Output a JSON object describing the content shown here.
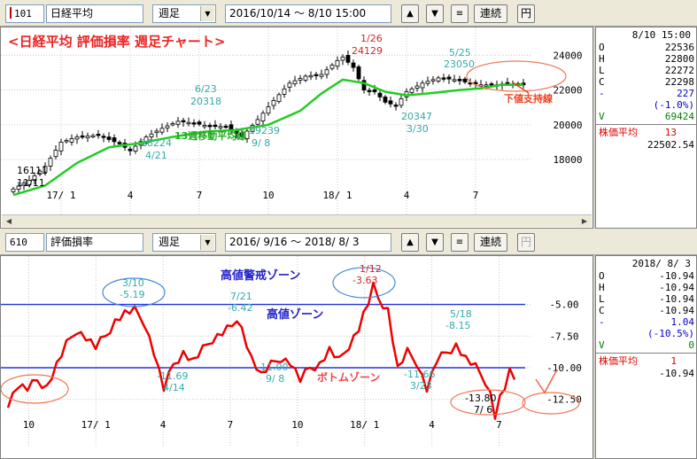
{
  "top": {
    "toolbar": {
      "code": "101",
      "name": "日経平均",
      "period": "週足",
      "date_range": "2016/10/14 ～  8/10 15:00",
      "list_button": "≡",
      "renzoku_button": "連続",
      "yen_button": "円"
    },
    "chart_title": "<日経平均  評価損率  週足チャート>",
    "annotations": {
      "ma_label": "13週移動平均線",
      "support_label": "下値支持線",
      "pk_1126": "1/26",
      "pk_1126_v": "24129",
      "pk_525": "5/25",
      "pk_525_v": "23050",
      "pk_623": "6/23",
      "pk_623_v": "20318",
      "lo_1111_v": "16111",
      "lo_1111": "11/11",
      "lo_421_v": "18224",
      "lo_421": "4/21",
      "lo_98_v": "19239",
      "lo_98": "9/ 8",
      "lo_330_v": "20347",
      "lo_330": "3/30"
    },
    "info": {
      "date": "8/10 15:00",
      "rows": [
        {
          "k": "O",
          "v": "22536"
        },
        {
          "k": "H",
          "v": "22800"
        },
        {
          "k": "L",
          "v": "22272"
        },
        {
          "k": "C",
          "v": "22298"
        },
        {
          "k": "-",
          "v": "227"
        },
        {
          "k": "",
          "v": "(-1.0%)"
        },
        {
          "k": "V",
          "v": "69424"
        }
      ],
      "sub_label": "株価平均",
      "sub_period": "13",
      "sub_value": "22502.54"
    }
  },
  "bottom": {
    "toolbar": {
      "code": "610",
      "name": "評価損率",
      "period": "週足",
      "date_range": "2016/ 9/16 ～  2018/ 8/ 3",
      "list_button": "≡",
      "renzoku_button": "連続",
      "yen_button": "円"
    },
    "annotations": {
      "zone_warn": "高値警戒ゾーン",
      "zone_high": "高値ゾーン",
      "zone_bottom": "ボトムゾーン",
      "pk_310": "3/10",
      "pk_310_v": "-5.19",
      "pk_721": "7/21",
      "pk_721_v": "-6.42",
      "pk_112": "1/12",
      "pk_112_v": "-3.63",
      "pk_518": "5/18",
      "pk_518_v": "-8.15",
      "lo_414_v": "-11.69",
      "lo_414": "4/14",
      "lo_98_v": "-11.00",
      "lo_98": "9/ 8",
      "lo_323_v": "-11.66",
      "lo_323": "3/23",
      "lo_76_v": "-13.80",
      "lo_76": "7/ 6"
    },
    "info": {
      "date": "2018/ 8/ 3",
      "rows": [
        {
          "k": "O",
          "v": "-10.94"
        },
        {
          "k": "H",
          "v": "-10.94"
        },
        {
          "k": "L",
          "v": "-10.94"
        },
        {
          "k": "C",
          "v": "-10.94"
        },
        {
          "k": "-",
          "v": "1.04"
        },
        {
          "k": "",
          "v": "(-10.5%)"
        },
        {
          "k": "V",
          "v": "0"
        }
      ],
      "sub_label": "株価平均",
      "sub_period": "1",
      "sub_value": "-10.94"
    }
  },
  "chart_data": [
    {
      "type": "candlestick",
      "title": "<日経平均  評価損率  週足チャート>",
      "ylim": [
        15600,
        25400
      ],
      "y_ticks": [
        "18000",
        "20000",
        "22000",
        "24000"
      ],
      "x_ticks": [
        "17/ 1",
        "4",
        "7",
        "10",
        "18/ 1",
        "4",
        "7"
      ],
      "x_tick_index": [
        9,
        22,
        35,
        48,
        61,
        74,
        87
      ],
      "n_weeks": 97,
      "series_name": "13週移動平均線",
      "close_anchors": [
        [
          0,
          16300
        ],
        [
          3,
          16800
        ],
        [
          6,
          17600
        ],
        [
          9,
          19000
        ],
        [
          12,
          19300
        ],
        [
          16,
          19400
        ],
        [
          20,
          18900
        ],
        [
          22,
          18500
        ],
        [
          25,
          19300
        ],
        [
          28,
          19800
        ],
        [
          31,
          20200
        ],
        [
          34,
          20100
        ],
        [
          37,
          19900
        ],
        [
          40,
          19900
        ],
        [
          43,
          19300
        ],
        [
          46,
          20300
        ],
        [
          49,
          21400
        ],
        [
          52,
          22400
        ],
        [
          55,
          22800
        ],
        [
          58,
          22900
        ],
        [
          61,
          23700
        ],
        [
          62,
          23900
        ],
        [
          64,
          23300
        ],
        [
          66,
          22000
        ],
        [
          68,
          21900
        ],
        [
          70,
          21300
        ],
        [
          72,
          21100
        ],
        [
          74,
          21900
        ],
        [
          77,
          22400
        ],
        [
          80,
          22700
        ],
        [
          83,
          22600
        ],
        [
          86,
          22400
        ],
        [
          88,
          22300
        ],
        [
          91,
          22300
        ],
        [
          93,
          22400
        ],
        [
          95,
          22300
        ]
      ],
      "ma_anchors": [
        [
          0,
          15950
        ],
        [
          6,
          16500
        ],
        [
          12,
          17800
        ],
        [
          18,
          18700
        ],
        [
          24,
          18950
        ],
        [
          30,
          19300
        ],
        [
          36,
          19600
        ],
        [
          42,
          19700
        ],
        [
          48,
          20000
        ],
        [
          54,
          20800
        ],
        [
          58,
          21800
        ],
        [
          62,
          22600
        ],
        [
          66,
          22400
        ],
        [
          70,
          21900
        ],
        [
          74,
          21700
        ],
        [
          78,
          21800
        ],
        [
          84,
          22000
        ],
        [
          88,
          22100
        ],
        [
          92,
          22300
        ],
        [
          95,
          22300
        ]
      ]
    },
    {
      "type": "line",
      "series_name": "評価損率",
      "ylim": [
        -15.6,
        -1.6
      ],
      "y_ticks": [
        "-5.00",
        "-7.50",
        "-10.00",
        "-12.50"
      ],
      "x_ticks": [
        "10",
        "17/ 1",
        "4",
        "7",
        "10",
        "18/ 1",
        "4",
        "7"
      ],
      "x_tick_index": [
        4,
        17,
        30,
        43,
        56,
        69,
        82,
        95
      ],
      "n_weeks": 99,
      "hlines": [
        -5.0,
        -10.0
      ],
      "anchors": [
        [
          0,
          -12.8
        ],
        [
          2,
          -11.4
        ],
        [
          4,
          -11.7
        ],
        [
          6,
          -11.0
        ],
        [
          8,
          -11.5
        ],
        [
          10,
          -9.8
        ],
        [
          12,
          -8.2
        ],
        [
          14,
          -7.0
        ],
        [
          16,
          -7.6
        ],
        [
          18,
          -8.4
        ],
        [
          20,
          -7.5
        ],
        [
          22,
          -6.3
        ],
        [
          24,
          -5.7
        ],
        [
          26,
          -5.5
        ],
        [
          28,
          -6.4
        ],
        [
          30,
          -8.8
        ],
        [
          32,
          -11.7
        ],
        [
          34,
          -9.7
        ],
        [
          36,
          -8.8
        ],
        [
          38,
          -9.5
        ],
        [
          40,
          -8.6
        ],
        [
          42,
          -7.7
        ],
        [
          44,
          -7.2
        ],
        [
          46,
          -6.6
        ],
        [
          48,
          -6.8
        ],
        [
          50,
          -9.2
        ],
        [
          52,
          -10.6
        ],
        [
          54,
          -9.8
        ],
        [
          56,
          -9.2
        ],
        [
          58,
          -9.6
        ],
        [
          60,
          -11.0
        ],
        [
          62,
          -10.0
        ],
        [
          64,
          -9.7
        ],
        [
          66,
          -8.6
        ],
        [
          68,
          -9.5
        ],
        [
          70,
          -8.2
        ],
        [
          72,
          -6.9
        ],
        [
          73,
          -5.8
        ],
        [
          74,
          -4.9
        ],
        [
          75,
          -3.63
        ],
        [
          76,
          -4.5
        ],
        [
          78,
          -5.4
        ],
        [
          80,
          -10.1
        ],
        [
          82,
          -8.8
        ],
        [
          84,
          -9.6
        ],
        [
          86,
          -11.66
        ],
        [
          88,
          -9.5
        ],
        [
          90,
          -8.8
        ],
        [
          92,
          -8.2
        ],
        [
          94,
          -9.3
        ],
        [
          96,
          -10.0
        ],
        [
          98,
          -11.0
        ],
        [
          99,
          -12.0
        ],
        [
          100,
          -13.8
        ],
        [
          101,
          -12.4
        ],
        [
          102,
          -11.6
        ],
        [
          103,
          -10.4
        ],
        [
          104,
          -10.94
        ]
      ]
    }
  ]
}
